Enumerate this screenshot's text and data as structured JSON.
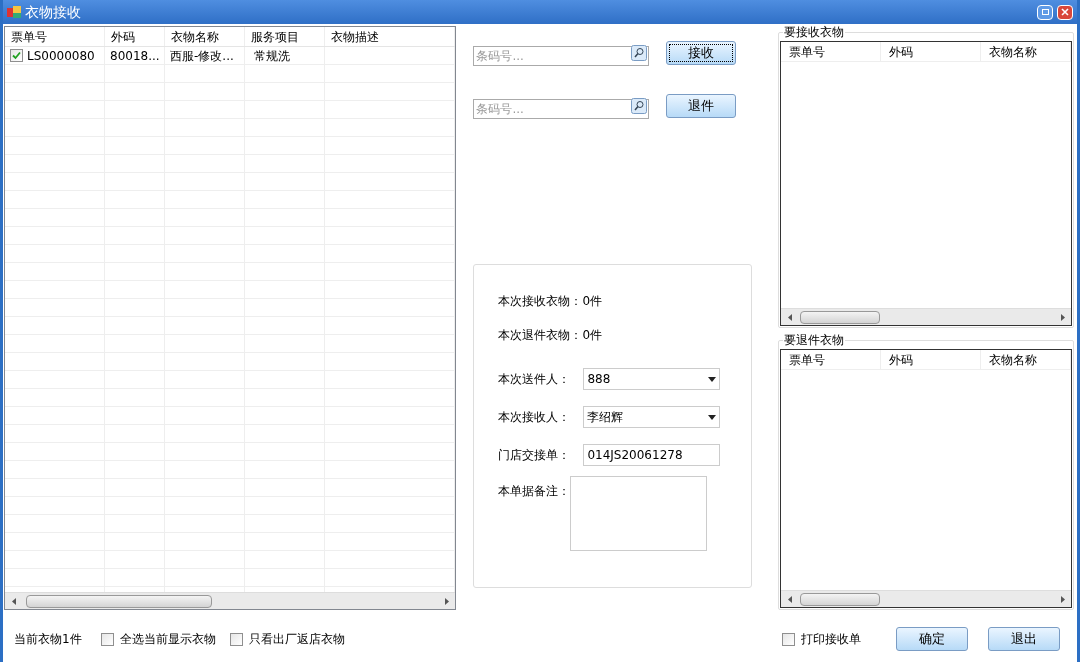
{
  "window": {
    "title": "衣物接收"
  },
  "main_grid": {
    "columns": [
      "票单号",
      "外码",
      "衣物名称",
      "服务项目",
      "衣物描述"
    ],
    "rows": [
      {
        "checked": true,
        "cells": [
          "LS0000080",
          "80018...",
          "西服-修改...",
          "常规洗",
          ""
        ]
      }
    ]
  },
  "scan_rows": [
    {
      "placeholder": "条码号...",
      "button": "接收",
      "focused": true
    },
    {
      "placeholder": "条码号...",
      "button": "退件",
      "focused": false
    }
  ],
  "summary": [
    "本次接收衣物：0件",
    "本次退件衣物：0件"
  ],
  "form_fields": [
    {
      "kind": "dropdown",
      "label": "本次送件人：",
      "value": "888"
    },
    {
      "kind": "dropdown",
      "label": "本次接收人：",
      "value": "李绍辉"
    },
    {
      "kind": "text",
      "label": "门店交接单：",
      "value": "014JS20061278"
    },
    {
      "kind": "textarea",
      "label": "本单据备注："
    }
  ],
  "side_groups": [
    {
      "title": "要接收衣物",
      "columns": [
        "票单号",
        "外码",
        "衣物名称"
      ]
    },
    {
      "title": "要退件衣物",
      "columns": [
        "票单号",
        "外码",
        "衣物名称"
      ]
    }
  ],
  "footer": {
    "count": "当前衣物1件",
    "filters": [
      {
        "label": "全选当前显示衣物",
        "checked": false
      },
      {
        "label": "只看出厂返店衣物",
        "checked": false
      }
    ],
    "print_option": {
      "label": "打印接收单",
      "checked": false
    },
    "buttons": [
      "确定",
      "退出"
    ]
  }
}
